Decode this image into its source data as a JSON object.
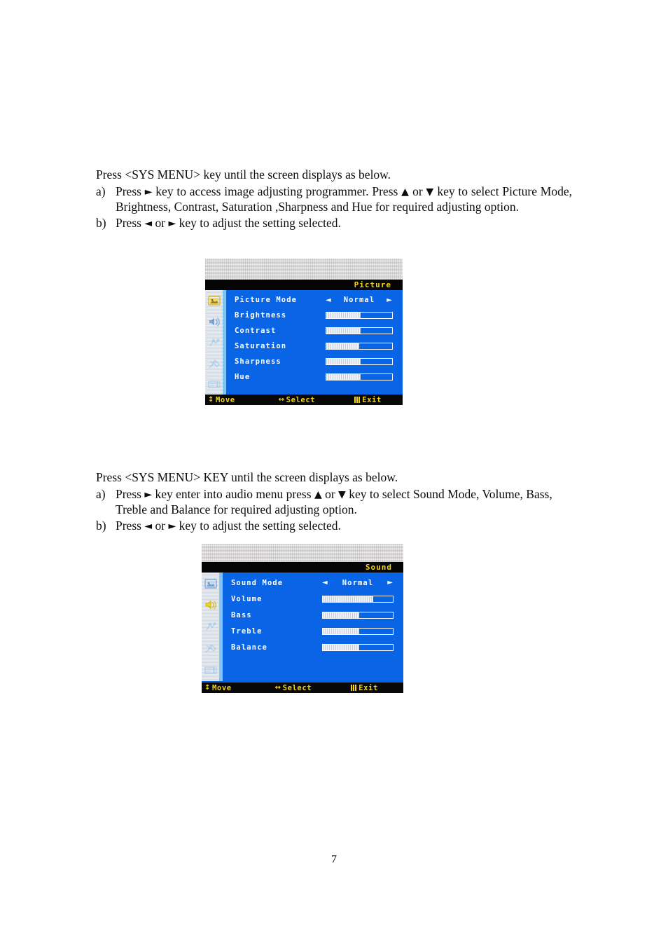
{
  "document": {
    "page_number": "7"
  },
  "section_picture": {
    "lead": "Press <SYS MENU> key until the screen displays as below.",
    "items": [
      {
        "marker": "a)",
        "part1": "Press",
        "arrow1": "►",
        "part2": "key to access image adjusting programmer. Press",
        "arrow2": "▲",
        "part3": "or",
        "arrow3": "▼",
        "part4": "key to select Picture Mode, Brightness, Contrast, Saturation ,Sharpness and Hue for required adjusting option."
      },
      {
        "marker": "b)",
        "part1": "Press",
        "arrow1": "◄",
        "part2": "or",
        "arrow2": "►",
        "part3": "key to adjust the setting selected."
      }
    ]
  },
  "section_sound": {
    "lead": "Press <SYS MENU> KEY until the screen displays as below.",
    "items": [
      {
        "marker": "a)",
        "part1": "Press",
        "arrow1": "►",
        "part2": "key enter into audio menu press",
        "arrow2": "▲",
        "part3": "or",
        "arrow3": "▼",
        "part4": "key to select Sound Mode, Volume, Bass, Treble and Balance for required adjusting option."
      },
      {
        "marker": "b)",
        "part1": "Press",
        "arrow1": "◄",
        "part2": "or",
        "arrow2": "►",
        "part3": "key to adjust the setting selected."
      }
    ]
  },
  "osd_picture": {
    "title": "Picture",
    "colors": {
      "background": "#0a64e6",
      "title_text": "#f2d318",
      "title_bar": "#050505",
      "label_text": "#ffffff",
      "bar_fill": "#eef2f7"
    },
    "rail_icons": [
      {
        "name": "picture-icon",
        "active": true
      },
      {
        "name": "sound-icon",
        "active": false
      },
      {
        "name": "function-icon",
        "active": false
      },
      {
        "name": "tools-icon",
        "active": false
      },
      {
        "name": "display-icon",
        "active": false
      }
    ],
    "rows": [
      {
        "label": "Picture Mode",
        "type": "option",
        "value": "Normal",
        "left_arrow": "◄",
        "right_arrow": "►"
      },
      {
        "label": "Brightness",
        "type": "slider",
        "fill": 52
      },
      {
        "label": "Contrast",
        "type": "slider",
        "fill": 52
      },
      {
        "label": "Saturation",
        "type": "slider",
        "fill": 50
      },
      {
        "label": "Sharpness",
        "type": "slider",
        "fill": 52
      },
      {
        "label": "Hue",
        "type": "slider",
        "fill": 52
      }
    ],
    "hints": [
      {
        "glyph": "↕",
        "label": "Move"
      },
      {
        "glyph": "↔",
        "label": "Select"
      },
      {
        "glyph": "bars",
        "label": "Exit"
      }
    ]
  },
  "osd_sound": {
    "title": "Sound",
    "colors": {
      "background": "#0a64e6",
      "title_text": "#f2d318",
      "title_bar": "#050505",
      "label_text": "#ffffff",
      "bar_fill": "#eef2f7"
    },
    "rail_icons": [
      {
        "name": "picture-icon",
        "active": false
      },
      {
        "name": "sound-icon",
        "active": true
      },
      {
        "name": "function-icon",
        "active": false
      },
      {
        "name": "tools-icon",
        "active": false
      },
      {
        "name": "display-icon",
        "active": false
      }
    ],
    "rows": [
      {
        "label": "Sound Mode",
        "type": "option",
        "value": "Normal",
        "left_arrow": "◄",
        "right_arrow": "►"
      },
      {
        "label": "Volume",
        "type": "slider",
        "fill": 72
      },
      {
        "label": "Bass",
        "type": "slider",
        "fill": 52
      },
      {
        "label": "Treble",
        "type": "slider",
        "fill": 52
      },
      {
        "label": "Balance",
        "type": "slider",
        "fill": 52
      }
    ],
    "hints": [
      {
        "glyph": "↕",
        "label": "Move"
      },
      {
        "glyph": "↔",
        "label": "Select"
      },
      {
        "glyph": "bars",
        "label": "Exit"
      }
    ]
  }
}
